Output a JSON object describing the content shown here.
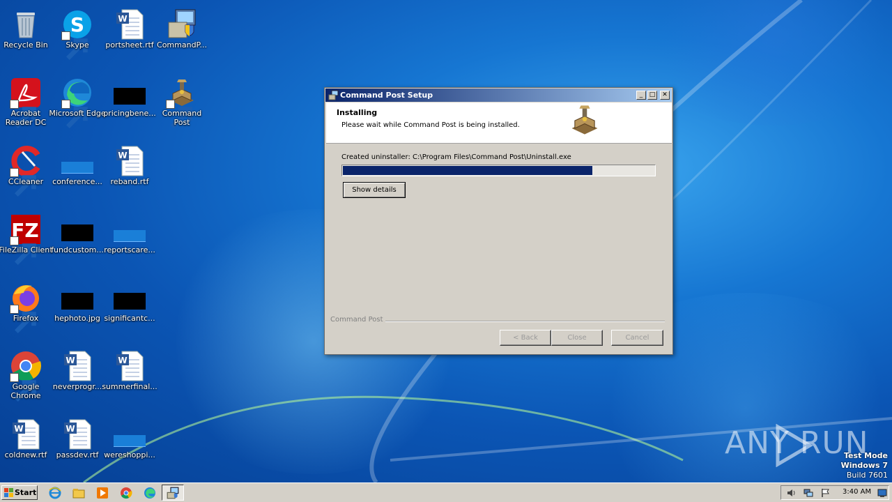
{
  "desktop": {
    "icons": [
      {
        "label": "Recycle Bin",
        "icon": "recycle-bin-icon"
      },
      {
        "label": "Skype",
        "icon": "skype-icon"
      },
      {
        "label": "portsheet.rtf",
        "icon": "word-document-icon"
      },
      {
        "label": "CommandP...",
        "icon": "installer-icon"
      },
      {
        "label": "Acrobat Reader DC",
        "icon": "acrobat-icon"
      },
      {
        "label": "Microsoft Edge",
        "icon": "edge-icon"
      },
      {
        "label": "pricingbene...",
        "icon": "black-thumbnail-icon"
      },
      {
        "label": "Command Post",
        "icon": "command-post-icon"
      },
      {
        "label": "CCleaner",
        "icon": "ccleaner-icon"
      },
      {
        "label": "conference...",
        "icon": "blue-thumbnail-icon"
      },
      {
        "label": "reband.rtf",
        "icon": "word-document-icon"
      },
      {
        "label": "FileZilla Client",
        "icon": "filezilla-icon"
      },
      {
        "label": "fundcustom...",
        "icon": "black-thumbnail-icon"
      },
      {
        "label": "reportscare...",
        "icon": "blue-thumbnail-icon"
      },
      {
        "label": "Firefox",
        "icon": "firefox-icon"
      },
      {
        "label": "hephoto.jpg",
        "icon": "black-thumbnail-icon"
      },
      {
        "label": "significantc...",
        "icon": "black-thumbnail-icon"
      },
      {
        "label": "Google Chrome",
        "icon": "chrome-icon"
      },
      {
        "label": "neverprogr...",
        "icon": "word-document-icon"
      },
      {
        "label": "summerfinal...",
        "icon": "word-document-icon"
      },
      {
        "label": "coldnew.rtf",
        "icon": "word-document-icon"
      },
      {
        "label": "passdev.rtf",
        "icon": "word-document-icon"
      },
      {
        "label": "wereshoppi...",
        "icon": "blue-thumbnail-icon"
      }
    ]
  },
  "dialog": {
    "title": "Command Post Setup",
    "header_title": "Installing",
    "header_subtitle": "Please wait while Command Post is being installed.",
    "status_text": "Created uninstaller: C:\\Program Files\\Command Post\\Uninstall.exe",
    "progress_fraction": 0.8,
    "show_details_label": "Show details",
    "branding": "Command Post",
    "back_label": "< Back",
    "close_label": "Close",
    "cancel_label": "Cancel",
    "minimize": "_",
    "maximize": "□",
    "close_x": "✕"
  },
  "taskbar": {
    "start_label": "Start",
    "clock": "3:40 AM"
  },
  "watermark": {
    "brand": "ANY RUN",
    "line1": "Test Mode",
    "line2": "Windows 7",
    "line3": "Build 7601"
  }
}
